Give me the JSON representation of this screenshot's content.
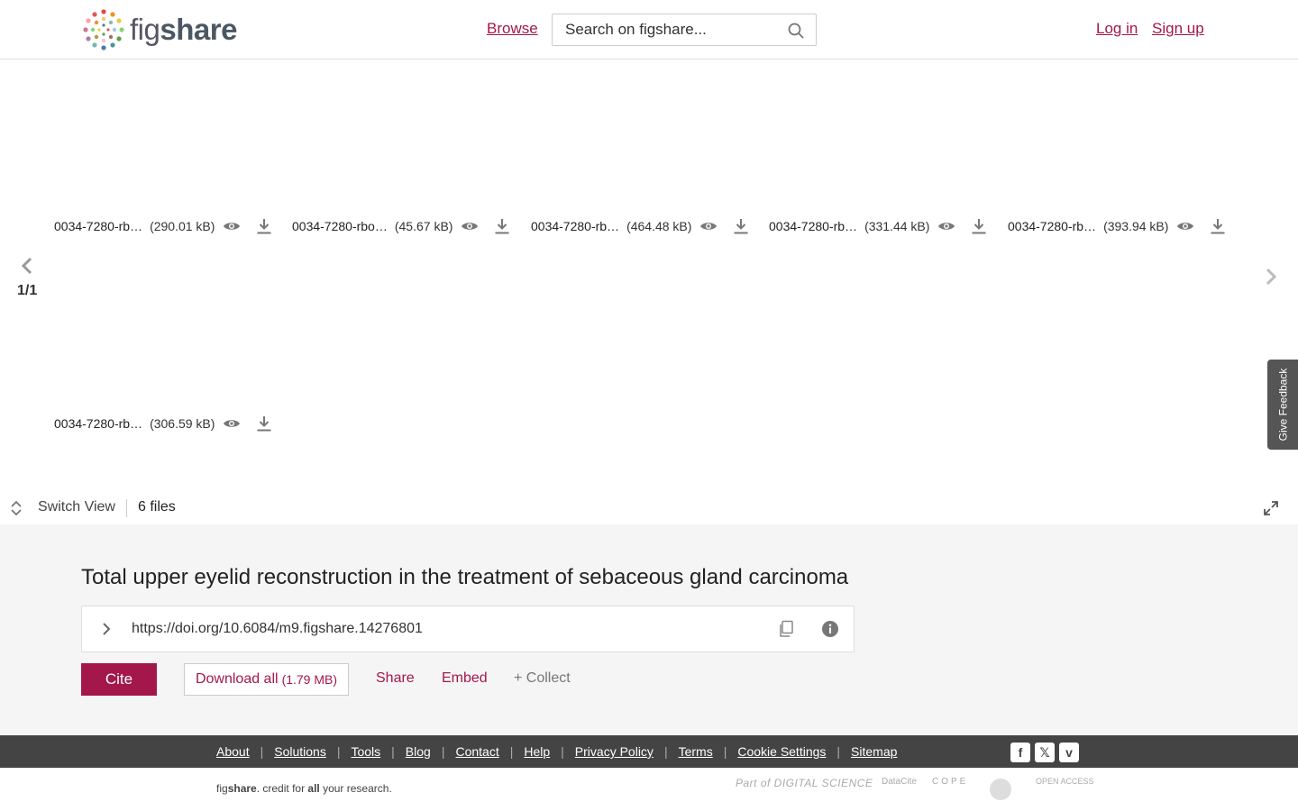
{
  "header": {
    "logo_text_light": "fig",
    "logo_text_bold": "share",
    "browse_label": "Browse",
    "search_placeholder": "Search on figshare...",
    "login_label": "Log in",
    "signup_label": "Sign up"
  },
  "files": [
    {
      "name": "0034-7280-rb…",
      "size": "(290.01 kB)"
    },
    {
      "name": "0034-7280-rbo…",
      "size": "(45.67 kB)"
    },
    {
      "name": "0034-7280-rb…",
      "size": "(464.48 kB)"
    },
    {
      "name": "0034-7280-rb…",
      "size": "(331.44 kB)"
    },
    {
      "name": "0034-7280-rb…",
      "size": "(393.94 kB)"
    },
    {
      "name": "0034-7280-rb…",
      "size": "(306.59 kB)"
    }
  ],
  "pager": {
    "count": "1/1"
  },
  "feedback_label": "Give Feedback",
  "switch_view_label": "Switch View",
  "file_count_label": "6 files",
  "item": {
    "title": "Total upper eyelid reconstruction in the treatment of sebaceous gland carcinoma",
    "doi": "https://doi.org/10.6084/m9.figshare.14276801",
    "cite_label": "Cite",
    "download_all_label": "Download all",
    "download_all_size": "(1.79 MB)",
    "share_label": "Share",
    "embed_label": "Embed",
    "collect_label": "+ Collect"
  },
  "footer": {
    "links": [
      "About",
      "Solutions",
      "Tools",
      "Blog",
      "Contact",
      "Help",
      "Privacy Policy",
      "Terms",
      "Cookie Settings",
      "Sitemap"
    ],
    "tagline_prefix": "fig",
    "tagline_brand": "share",
    "tagline_mid": ". credit for ",
    "tagline_bold": "all",
    "tagline_suffix": " your research.",
    "partners": [
      "Part of DIGITAL SCIENCE",
      "DataCite",
      "COPE",
      "OPEN ACCESS"
    ]
  },
  "colors": {
    "brand": "#a3174b",
    "footer_bg": "#444444",
    "details_bg": "#f5f5f5"
  }
}
